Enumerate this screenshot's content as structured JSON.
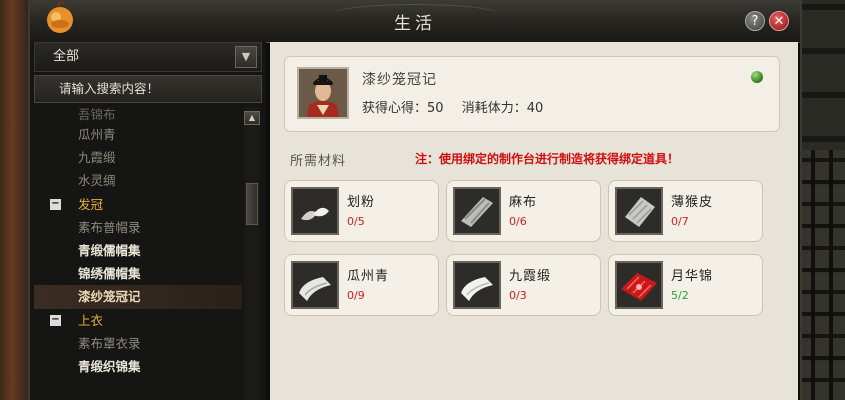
{
  "window": {
    "title": "生活"
  },
  "left": {
    "category_selected": "全部",
    "search_placeholder": "请输入搜索内容！",
    "list": [
      {
        "type": "item",
        "label": "吾锦布",
        "style": "first"
      },
      {
        "type": "item",
        "label": "瓜州青",
        "style": "dim"
      },
      {
        "type": "item",
        "label": "九霞缎",
        "style": "dim"
      },
      {
        "type": "item",
        "label": "水灵绸",
        "style": "dim"
      },
      {
        "type": "cat",
        "label": "发冠",
        "expand": "−"
      },
      {
        "type": "item",
        "label": "素布普帽录",
        "style": "dim"
      },
      {
        "type": "item",
        "label": "青缎儒帽集",
        "style": "bright"
      },
      {
        "type": "item",
        "label": "锦绣儒帽集",
        "style": "bright"
      },
      {
        "type": "item",
        "label": "漆纱笼冠记",
        "style": "selected"
      },
      {
        "type": "cat",
        "label": "上衣",
        "expand": "−"
      },
      {
        "type": "item",
        "label": "素布罩衣录",
        "style": "dim"
      },
      {
        "type": "item",
        "label": "青缎织锦集",
        "style": "bright"
      }
    ]
  },
  "recipe": {
    "name": "漆纱笼冠记",
    "insight_label": "获得心得：50",
    "stamina_label": "消耗体力：40"
  },
  "materials_header": "所需材料",
  "warning": "注：使用绑定的制作台进行制造将获得绑定道具！",
  "materials": [
    {
      "name": "划粉",
      "count": "0/5",
      "status": "red",
      "icon": "chalk-icon"
    },
    {
      "name": "麻布",
      "count": "0/6",
      "status": "red",
      "icon": "linen-cloth-icon"
    },
    {
      "name": "薄猴皮",
      "count": "0/7",
      "status": "red",
      "icon": "monkey-hide-icon"
    },
    {
      "name": "瓜州青",
      "count": "0/9",
      "status": "red",
      "icon": "folded-cloth-icon"
    },
    {
      "name": "九霞缎",
      "count": "0/3",
      "status": "red",
      "icon": "satin-icon"
    },
    {
      "name": "月华锦",
      "count": "5/2",
      "status": "green",
      "icon": "red-brocade-icon"
    }
  ],
  "colors": {
    "warning": "#d01010",
    "category": "#e9b03a",
    "have": "#2aa22a",
    "missing": "#d02020"
  }
}
